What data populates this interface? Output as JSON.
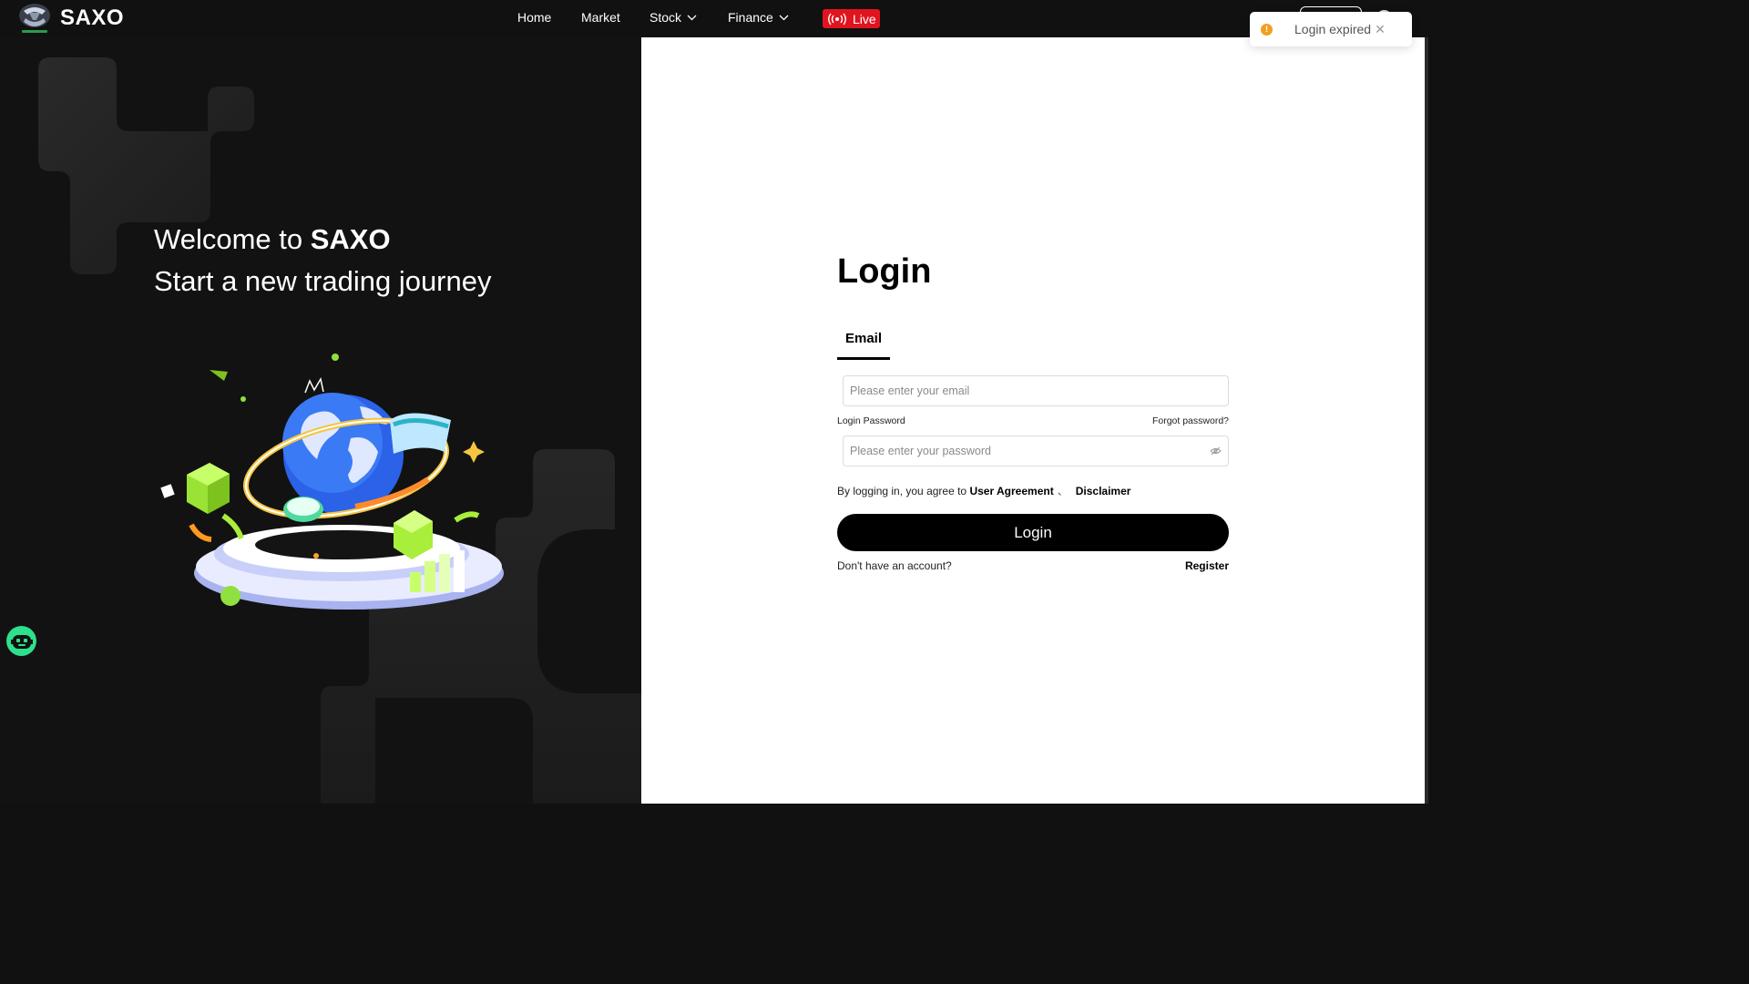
{
  "brand": {
    "name": "SAXO",
    "logo_icon": "saxo-logo-icon"
  },
  "nav": {
    "items": [
      {
        "label": "Home"
      },
      {
        "label": "Market"
      },
      {
        "label": "Stock"
      },
      {
        "label": "Finance"
      }
    ],
    "live_label": "Live"
  },
  "hero": {
    "welcome_prefix": "Welcome to ",
    "welcome_brand": "SAXO",
    "tagline": "Start a new trading journey"
  },
  "login": {
    "title": "Login",
    "tab_email": "Email",
    "email_placeholder": "Please enter your email",
    "password_label": "Login Password",
    "forgot_label": "Forgot password?",
    "password_placeholder": "Please enter your password",
    "agree_prefix": "By logging in, you agree to ",
    "user_agreement": "User Agreement",
    "separator": "、",
    "disclaimer": "Disclaimer",
    "button_label": "Login",
    "no_account": "Don't have an account?",
    "register": "Register"
  },
  "toast": {
    "message": "Login expired",
    "close_glyph": "✕"
  },
  "colors": {
    "accent_green": "#2ee08b",
    "live_red": "#e0141f",
    "warn_orange": "#f0a020",
    "dark_bg": "#121212"
  }
}
